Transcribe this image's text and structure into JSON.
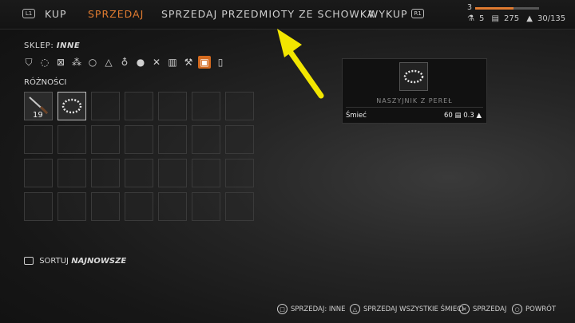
{
  "nav": {
    "left_button": "L1",
    "right_button": "R1",
    "tabs": [
      "KUP",
      "SPRZEDAJ",
      "SPRZEDAJ PRZEDMIOTY ZE SCHOWKA",
      "WYKUP"
    ],
    "active_tab": "SPRZEDAJ"
  },
  "player": {
    "level": "3",
    "xp_progress": 0.6,
    "potions": "5",
    "crowns": "275",
    "weight": "30/135"
  },
  "shop": {
    "label": "SKLEP:",
    "name": "INNE",
    "categories": [
      "weapon",
      "ring",
      "trap",
      "bombs",
      "ring2",
      "alchemy",
      "potion",
      "food",
      "tools",
      "book",
      "craft",
      "junk",
      "quest"
    ],
    "section_label": "RÓŻNOŚCI"
  },
  "inventory": {
    "items": [
      {
        "name": "sztylet",
        "qty": "19"
      },
      {
        "name": "naszyjnik",
        "qty": ""
      }
    ]
  },
  "tooltip": {
    "title": "NASZYJNIK Z PEREŁ",
    "type": "Śmieć",
    "price": "60",
    "weight": "0.3"
  },
  "sort": {
    "label": "SORTUJ",
    "value": "NAJNOWSZE"
  },
  "footer": {
    "sell_category": "SPRZEDAJ: INNE",
    "sell_junk": "SPRZEDAJ WSZYSTKIE ŚMIECI",
    "sell": "SPRZEDAJ",
    "back": "POWRÓT"
  }
}
